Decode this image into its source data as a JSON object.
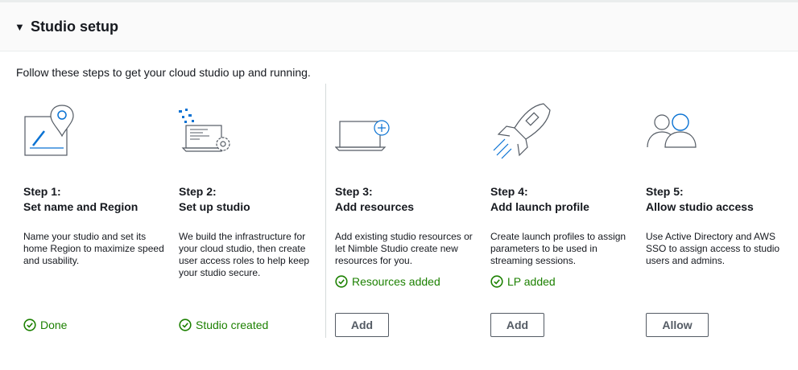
{
  "panel": {
    "title": "Studio setup",
    "expanded": true
  },
  "intro": "Follow these steps to get your cloud studio up and running.",
  "colors": {
    "success": "#1d8102",
    "accent": "#0972d3",
    "text": "#16191f",
    "button_border": "#545b64"
  },
  "steps": [
    {
      "number": "Step 1:",
      "title": "Set name and Region",
      "description": "Name your studio and set its home Region to maximize speed and usability.",
      "icon": "map-pin-edit-icon",
      "status": "Done",
      "button": null
    },
    {
      "number": "Step 2:",
      "title": "Set up studio",
      "description": "We build the infrastructure for your cloud studio, then create user access roles to help keep your studio secure.",
      "icon": "laptop-gear-icon",
      "status": "Studio created",
      "button": null
    },
    {
      "number": "Step 3:",
      "title": "Add resources",
      "description": "Add existing studio resources or let Nimble Studio create new resources for you.",
      "icon": "laptop-add-icon",
      "status": "Resources added",
      "button": "Add"
    },
    {
      "number": "Step 4:",
      "title": "Add launch profile",
      "description": "Create launch profiles to assign parameters to be used in streaming sessions.",
      "icon": "rocket-icon",
      "status": "LP added",
      "button": "Add"
    },
    {
      "number": "Step 5:",
      "title": "Allow studio access",
      "description": "Use Active Directory and AWS SSO to assign access to studio users and admins.",
      "icon": "users-icon",
      "status": null,
      "button": "Allow"
    }
  ]
}
